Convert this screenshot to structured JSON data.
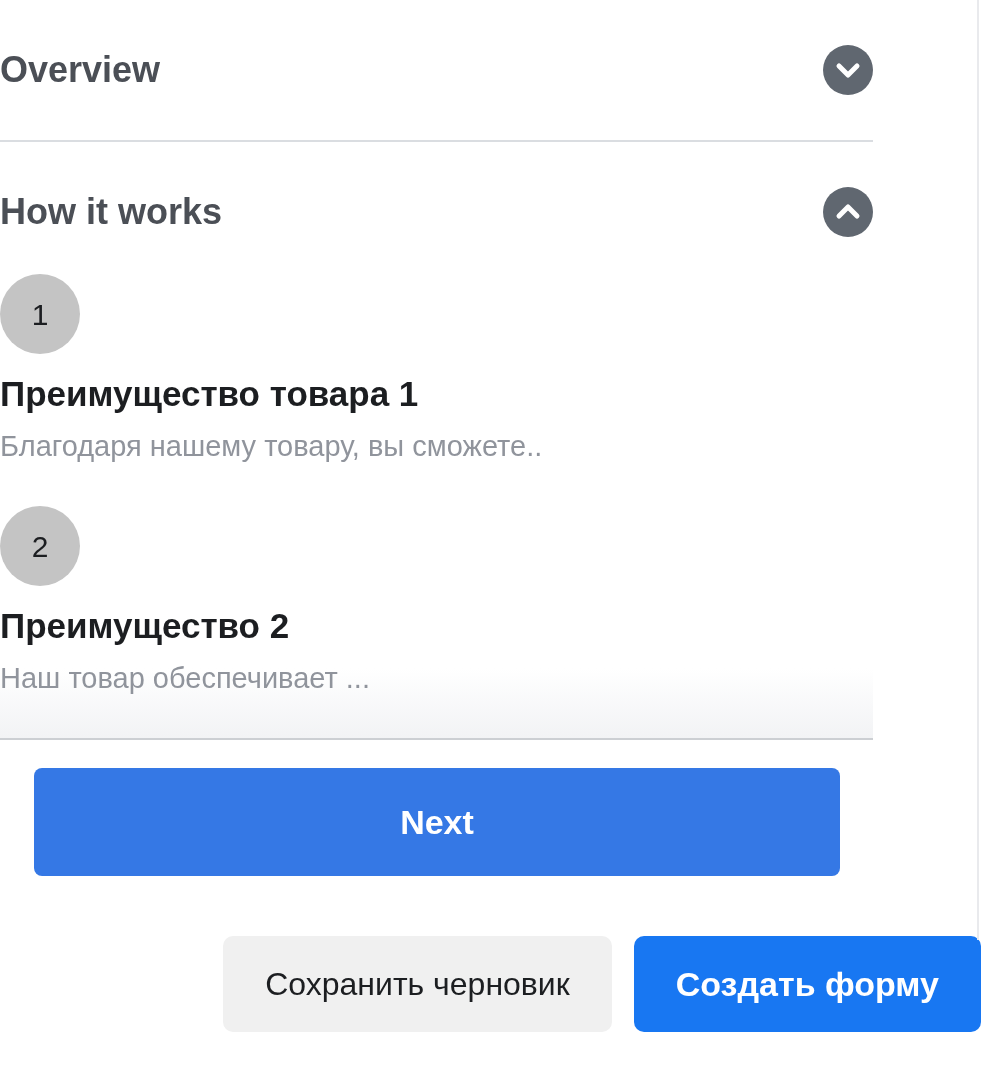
{
  "sections": [
    {
      "title": "Overview",
      "expanded": false
    },
    {
      "title": "How it works",
      "expanded": true,
      "steps": [
        {
          "number": "1",
          "title": "Преимущество товара 1",
          "description": "Благодаря нашему товару, вы сможете.."
        },
        {
          "number": "2",
          "title": "Преимущество 2",
          "description": "Наш товар обеспечивает ..."
        }
      ]
    }
  ],
  "next_button": "Next",
  "footer_buttons": [
    {
      "label": "Сохранить черновик",
      "kind": "secondary"
    },
    {
      "label": "Создать форму",
      "kind": "primary"
    }
  ]
}
